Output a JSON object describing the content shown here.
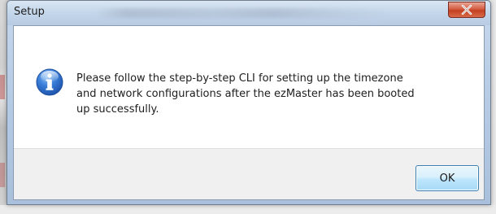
{
  "window": {
    "title": "Setup"
  },
  "dialog": {
    "icon": "info-icon",
    "message": "Please follow the step-by-step CLI for setting up the timezone\nand network configurations after the ezMaster has been booted\nup successfully.",
    "ok_label": "OK"
  },
  "colors": {
    "info_icon": "#2d6fd0",
    "close_button": "#c8462a",
    "ok_button_border": "#3c7fb1"
  }
}
